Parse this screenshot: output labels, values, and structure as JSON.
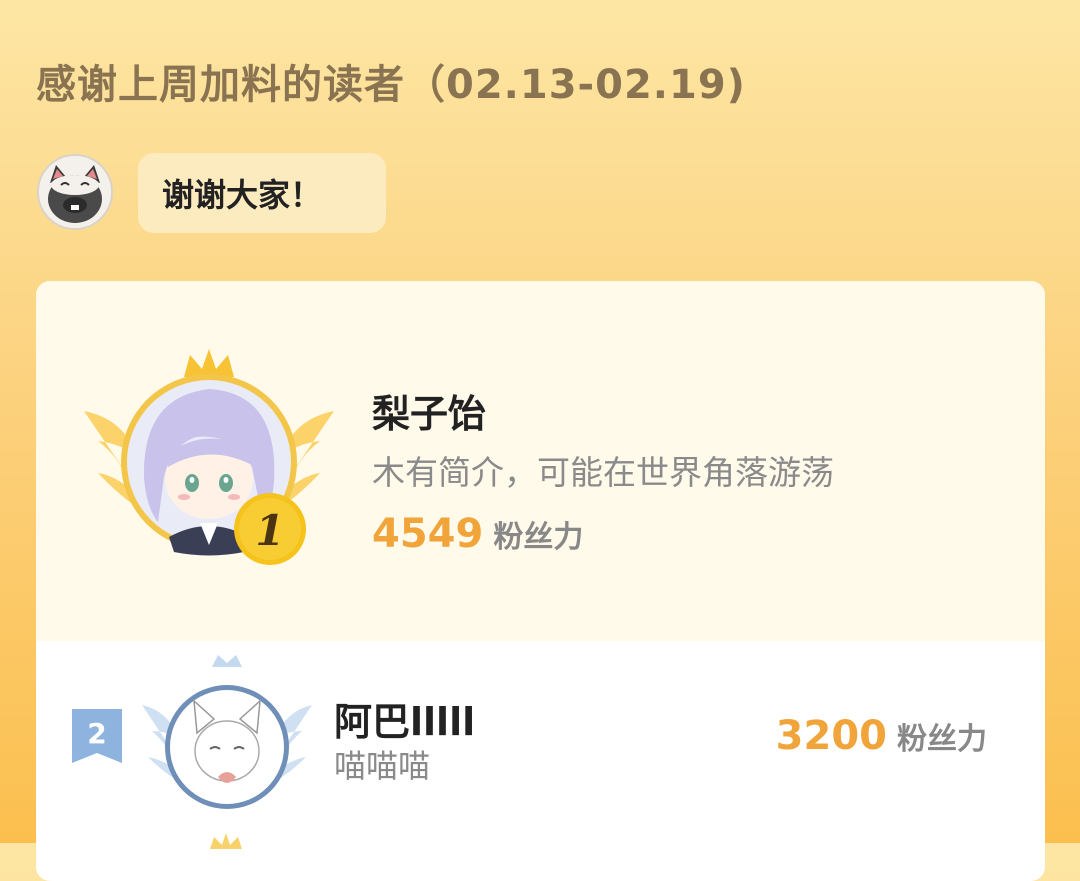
{
  "header": {
    "title": "感谢上周加料的读者（02.13-02.19)"
  },
  "greeting": {
    "mascot_icon": "cat-mascot-icon",
    "message": "谢谢大家！"
  },
  "leaderboard": [
    {
      "rank": "1",
      "name": "梨子饴",
      "bio": "木有简介，可能在世界角落游荡",
      "score": "4549",
      "unit": "粉丝力"
    },
    {
      "rank": "2",
      "name": "阿巴lllll",
      "bio": "喵喵喵",
      "score": "3200",
      "unit": "粉丝力"
    }
  ],
  "colors": {
    "accent": "#f0a43a",
    "gold": "#f5c22f",
    "silver_blue": "#8fb3df"
  }
}
